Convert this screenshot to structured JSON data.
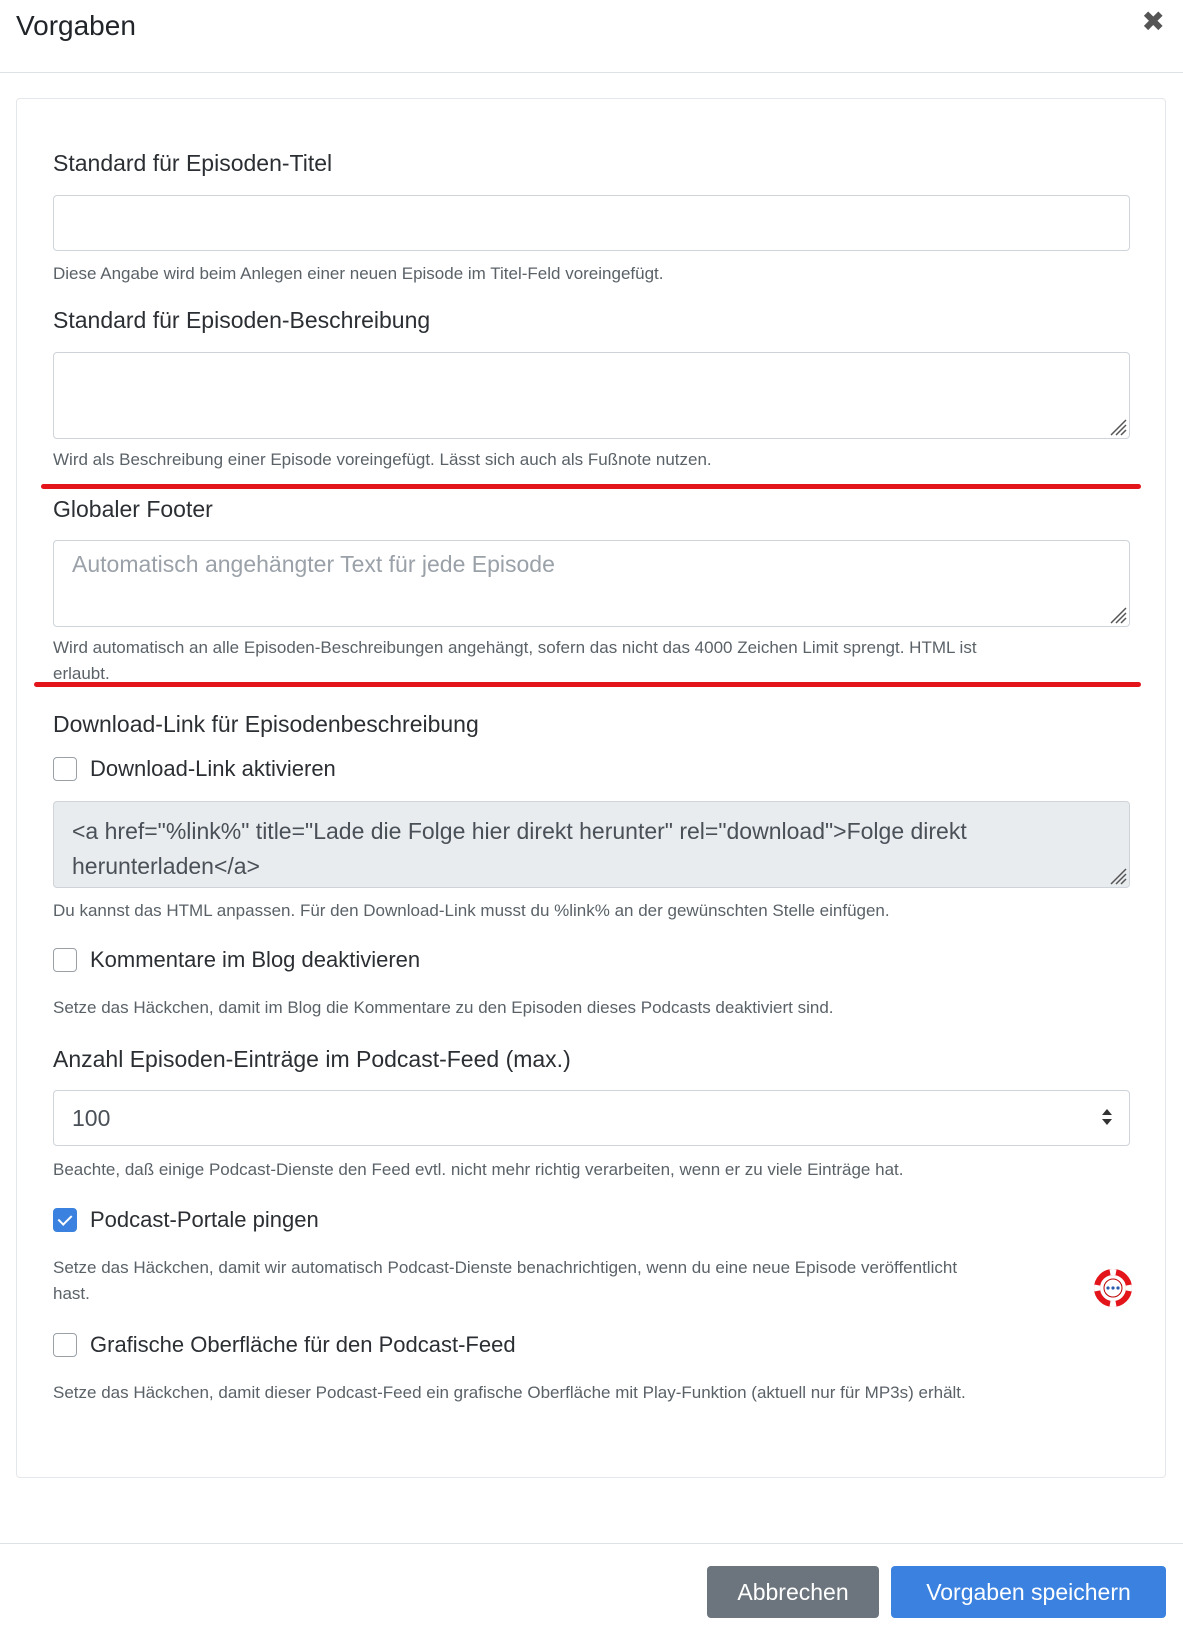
{
  "modal": {
    "title": "Vorgaben",
    "close_icon": "close-icon"
  },
  "episode_title": {
    "label": "Standard für Episoden-Titel",
    "value": "",
    "help": "Diese Angabe wird beim Anlegen einer neuen Episode im Titel-Feld voreingefügt."
  },
  "episode_description": {
    "label": "Standard für Episoden-Beschreibung",
    "value": "",
    "help": "Wird als Beschreibung einer Episode voreingefügt. Lässt sich auch als Fußnote nutzen."
  },
  "global_footer": {
    "label": "Globaler Footer",
    "placeholder": "Automatisch angehängter Text für jede Episode",
    "help_line1": "Wird automatisch an alle Episoden-Beschreibungen angehängt, sofern das nicht das 4000 Zeichen Limit sprengt. HTML ist",
    "help_line2": "erlaubt."
  },
  "download_link": {
    "label": "Download-Link für Episodenbeschreibung",
    "checkbox_label": "Download-Link aktivieren",
    "checked": false,
    "html_line1": "<a href=\"%link%\" title=\"Lade die Folge hier direkt herunter\" rel=\"download\">Folge direkt",
    "html_line2": "herunterladen</a>",
    "help": "Du kannst das HTML anpassen. Für den Download-Link musst du %link% an der gewünschten Stelle einfügen."
  },
  "comments": {
    "checkbox_label": "Kommentare im Blog deaktivieren",
    "checked": false,
    "help": "Setze das Häckchen, damit im Blog die Kommentare zu den Episoden dieses Podcasts deaktiviert sind."
  },
  "feed_entries": {
    "label": "Anzahl Episoden-Einträge im Podcast-Feed (max.)",
    "selected": "100",
    "help": "Beachte, daß einige Podcast-Dienste den Feed evtl. nicht mehr richtig verarbeiten, wenn er zu viele Einträge hat."
  },
  "ping_portals": {
    "checkbox_label": "Podcast-Portale pingen",
    "checked": true,
    "help_line1": "Setze das Häckchen, damit wir automatisch Podcast-Dienste benachrichtigen, wenn du eine neue Episode veröffentlicht",
    "help_line2": "hast.",
    "help_icon": "lifebuoy-icon"
  },
  "graphic_feed": {
    "checkbox_label": "Grafische Oberfläche für den Podcast-Feed",
    "checked": false,
    "help": "Setze das Häckchen, damit dieser Podcast-Feed ein grafische Oberfläche mit Play-Funktion (aktuell nur für MP3s) erhält."
  },
  "buttons": {
    "cancel": "Abbrechen",
    "save": "Vorgaben speichern"
  },
  "colors": {
    "primary": "#3b82e0",
    "secondary": "#6c757d",
    "annotation_red": "#e3141a"
  }
}
